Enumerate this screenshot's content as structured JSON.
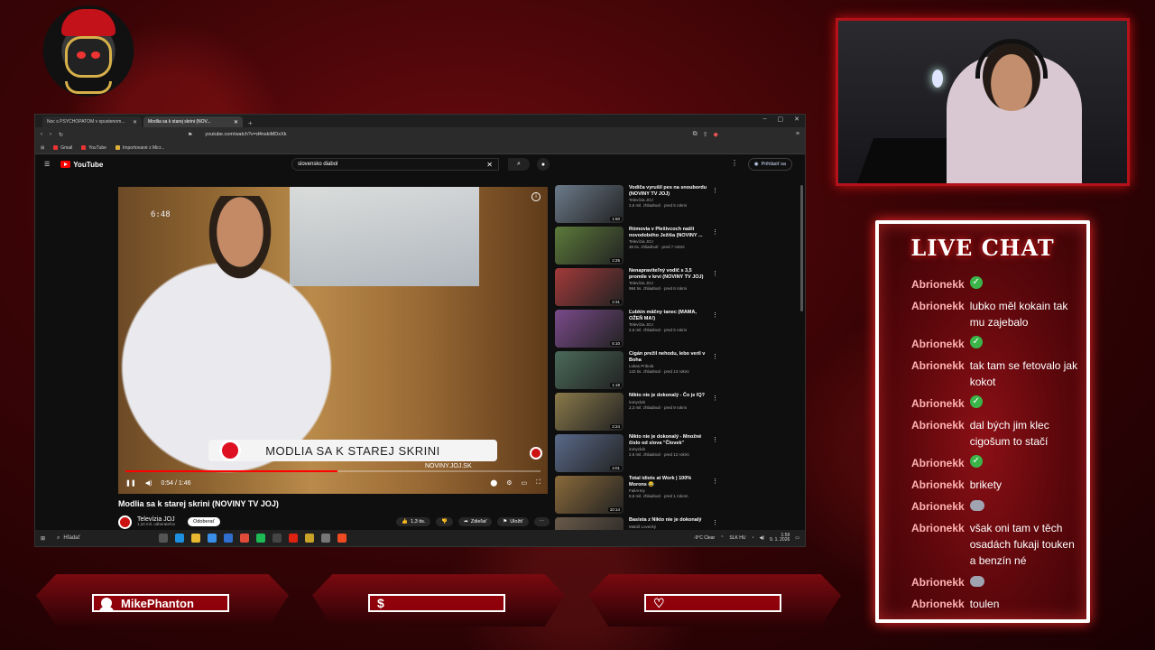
{
  "browser": {
    "tabs": [
      {
        "label": "Noc s PSYCHOPATOM v opustenom..."
      },
      {
        "label": "Modlia sa k starej skrini (NOV..."
      }
    ],
    "url": "youtube.com/watch?v=d4nskiMDxXk",
    "bookmarks": [
      {
        "label": "Gmail"
      },
      {
        "label": "YouTube"
      },
      {
        "label": "Importované z Micr..."
      }
    ]
  },
  "youtube": {
    "brand": "YouTube",
    "search_query": "slovensko diabol",
    "signin_label": "Prihlásiť sa",
    "video": {
      "overlay_time": "6:48",
      "lower_third": "MODLIA SA K STAREJ SKRINI",
      "lower_third_sub": "NOVINY.JOJ.SK",
      "time_display": "0:54 / 1:46",
      "progress": 0.51
    },
    "title": "Modlia sa k starej skrini (NOVINY TV JOJ)",
    "channel": {
      "name": "Televízia JOJ",
      "subs": "1,34 mil. odberateľov",
      "subscribe_label": "Odoberať"
    },
    "actions": {
      "likes": "1,3 tis.",
      "share": "Zdieľať",
      "save": "Uložiť"
    },
    "recommendations": [
      {
        "title": "Vodiča vyrušil pes na snoubordu (NOVINY TV JOJ)",
        "channel": "Televízia JOJ",
        "views": "2,5 mil. zhliadnutí · pred 5 rokmi",
        "duration": "1:50",
        "color": "#6b7a8a"
      },
      {
        "title": "Rómovia v Plešivcoch našli novodobého Ježiša (NOVINY ...",
        "channel": "Televízia JOJ",
        "views": "36 tis. zhliadnutí · pred 7 rokmi",
        "duration": "2:25",
        "color": "#5c7a3a"
      },
      {
        "title": "Nenapraviteľný vodič s 3,5 promile v krvi (NOVINY TV JOJ)",
        "channel": "Televízia JOJ",
        "views": "984 tis. zhliadnutí · pred 6 rokmi",
        "duration": "2:31",
        "color": "#a33a3a"
      },
      {
        "title": "Ľubkin mäčny tanec (MAMA, OŽEŇ MA!)",
        "channel": "Televízia JOJ",
        "views": "2,6 mil. zhliadnutí · pred 5 rokmi",
        "duration": "5:10",
        "color": "#7a4a8a"
      },
      {
        "title": "Cigán prežil nehodu, lebo veril v Boha",
        "channel": "Lukas Pribula",
        "views": "142 tis. zhliadnutí · pred 13 rokmi",
        "duration": "1:18",
        "color": "#4a6a5a"
      },
      {
        "title": "Nikto nie je dokonalý - Čo je IQ?",
        "channel": "ironyclub",
        "views": "2,3 mil. zhliadnutí · pred 9 rokmi",
        "duration": "2:24",
        "color": "#8a7a4a"
      },
      {
        "title": "Nikto nie je dokonalý - Množné číslo od slova \"Človek\"",
        "channel": "ironyclub",
        "views": "2,5 mil. zhliadnutí · pred 12 rokmi",
        "duration": "4:01",
        "color": "#5a6a8a"
      },
      {
        "title": "Total idiots at Work | 100% Morons 😂",
        "channel": "FailArmy",
        "views": "8,8 mil. zhliadnutí · pred 1 rokom",
        "duration": "10:14",
        "color": "#8a6a3a"
      },
      {
        "title": "Basista z Nikto nie je dokonalý",
        "channel": "Matúš Lovecký",
        "views": "",
        "duration": "",
        "color": "#6a5a4a"
      }
    ]
  },
  "taskbar": {
    "search_placeholder": "Hľadať",
    "weather": "-9°C  Clear",
    "lang": "SLK\nHU",
    "time": "1:59",
    "date": "9. 1. 2026"
  },
  "chat": {
    "title": "LIVE CHAT",
    "messages": [
      {
        "user": "Abrionekk",
        "text": "",
        "emote": "check"
      },
      {
        "user": "Abrionekk",
        "text": "lubko měl kokain tak mu zajebalo",
        "emote": ""
      },
      {
        "user": "Abrionekk",
        "text": "",
        "emote": "check"
      },
      {
        "user": "Abrionekk",
        "text": "tak tam se fetovalo jak kokot",
        "emote": ""
      },
      {
        "user": "Abrionekk",
        "text": "",
        "emote": "check"
      },
      {
        "user": "Abrionekk",
        "text": "dal bých jim klec cigošum to stačí",
        "emote": ""
      },
      {
        "user": "Abrionekk",
        "text": "",
        "emote": "check"
      },
      {
        "user": "Abrionekk",
        "text": "brikety",
        "emote": ""
      },
      {
        "user": "Abrionekk",
        "text": "",
        "emote": "face"
      },
      {
        "user": "Abrionekk",
        "text": "však oni tam v těch osadách fukaji touken a benzín né",
        "emote": ""
      },
      {
        "user": "Abrionekk",
        "text": "",
        "emote": "face"
      },
      {
        "user": "Abrionekk",
        "text": "toulen",
        "emote": ""
      }
    ]
  },
  "bottom_bars": [
    {
      "icon": "user-icon",
      "label": "MikePhanton"
    },
    {
      "icon": "dollar-icon",
      "label": ""
    },
    {
      "icon": "heart-icon",
      "label": ""
    }
  ]
}
